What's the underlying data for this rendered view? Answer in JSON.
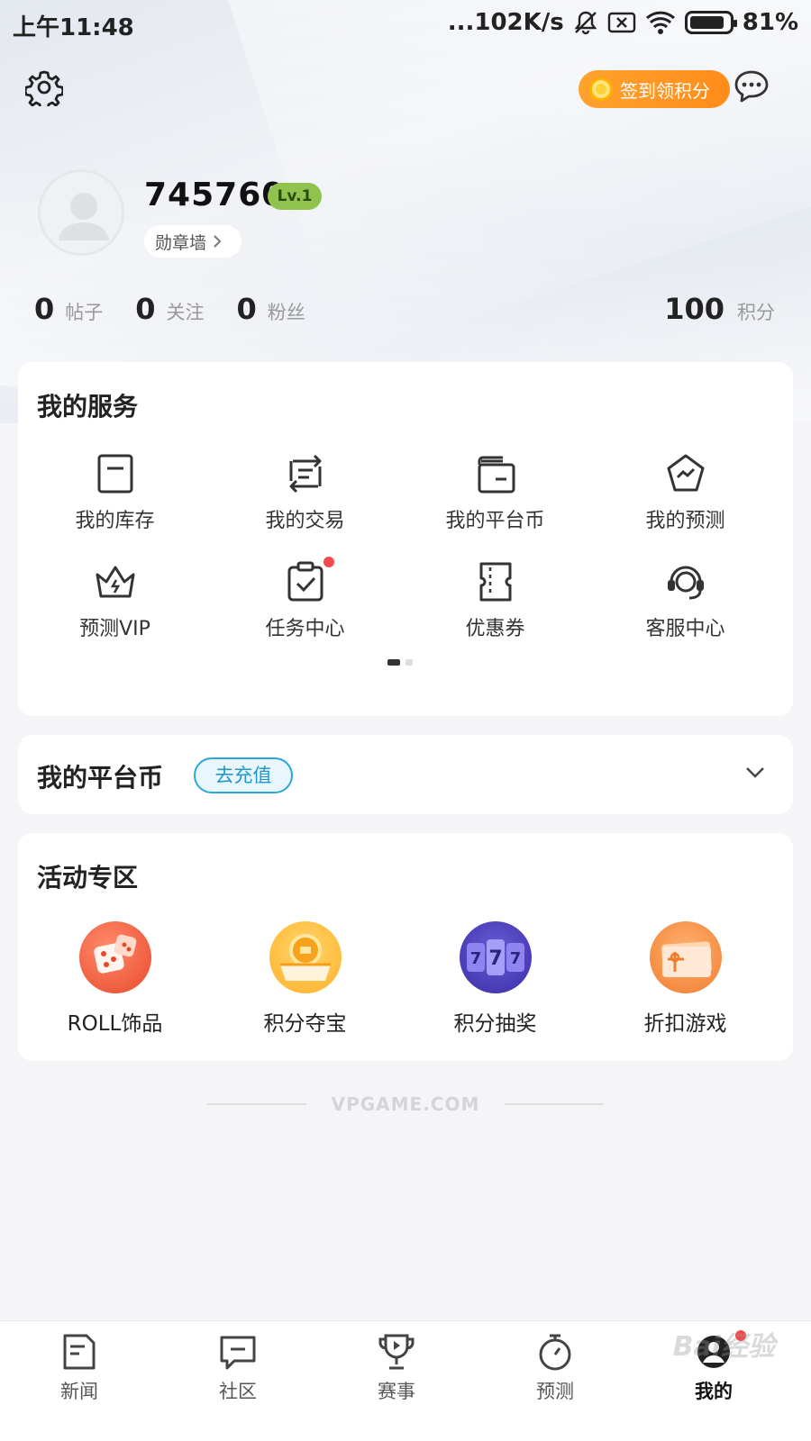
{
  "status_bar": {
    "time": "上午11:48",
    "speed": "...102K/s",
    "battery": "81%"
  },
  "header": {
    "checkin_label": "签到领积分"
  },
  "profile": {
    "username": "745760",
    "level": "Lv.1",
    "medal_wall": "勋章墙",
    "stats": [
      {
        "value": "0",
        "label": "帖子"
      },
      {
        "value": "0",
        "label": "关注"
      },
      {
        "value": "0",
        "label": "粉丝"
      }
    ],
    "points_value": "100",
    "points_label": "积分"
  },
  "services": {
    "title": "我的服务",
    "items": [
      {
        "label": "我的库存",
        "icon": "inventory-icon"
      },
      {
        "label": "我的交易",
        "icon": "trade-icon"
      },
      {
        "label": "我的平台币",
        "icon": "wallet-icon"
      },
      {
        "label": "我的预测",
        "icon": "prediction-icon"
      },
      {
        "label": "预测VIP",
        "icon": "crown-icon"
      },
      {
        "label": "任务中心",
        "icon": "task-icon"
      },
      {
        "label": "优惠券",
        "icon": "coupon-icon"
      },
      {
        "label": "客服中心",
        "icon": "headset-icon"
      }
    ],
    "page_index": 1,
    "page_count": 2
  },
  "platform_coin": {
    "title": "我的平台币",
    "recharge_label": "去充值"
  },
  "activities": {
    "title": "活动专区",
    "items": [
      {
        "label": "ROLL饰品",
        "icon": "dice-icon"
      },
      {
        "label": "积分夺宝",
        "icon": "treasure-icon"
      },
      {
        "label": "积分抽奖",
        "icon": "slot-machine-icon"
      },
      {
        "label": "折扣游戏",
        "icon": "gift-card-icon"
      }
    ]
  },
  "footer": {
    "brand": "VPGAME.COM"
  },
  "tabs": [
    {
      "label": "新闻",
      "icon": "news-icon"
    },
    {
      "label": "社区",
      "icon": "community-icon"
    },
    {
      "label": "赛事",
      "icon": "trophy-icon"
    },
    {
      "label": "预测",
      "icon": "stopwatch-icon"
    },
    {
      "label": "我的",
      "icon": "profile-icon",
      "active": true
    }
  ],
  "watermark": "Bai经验"
}
